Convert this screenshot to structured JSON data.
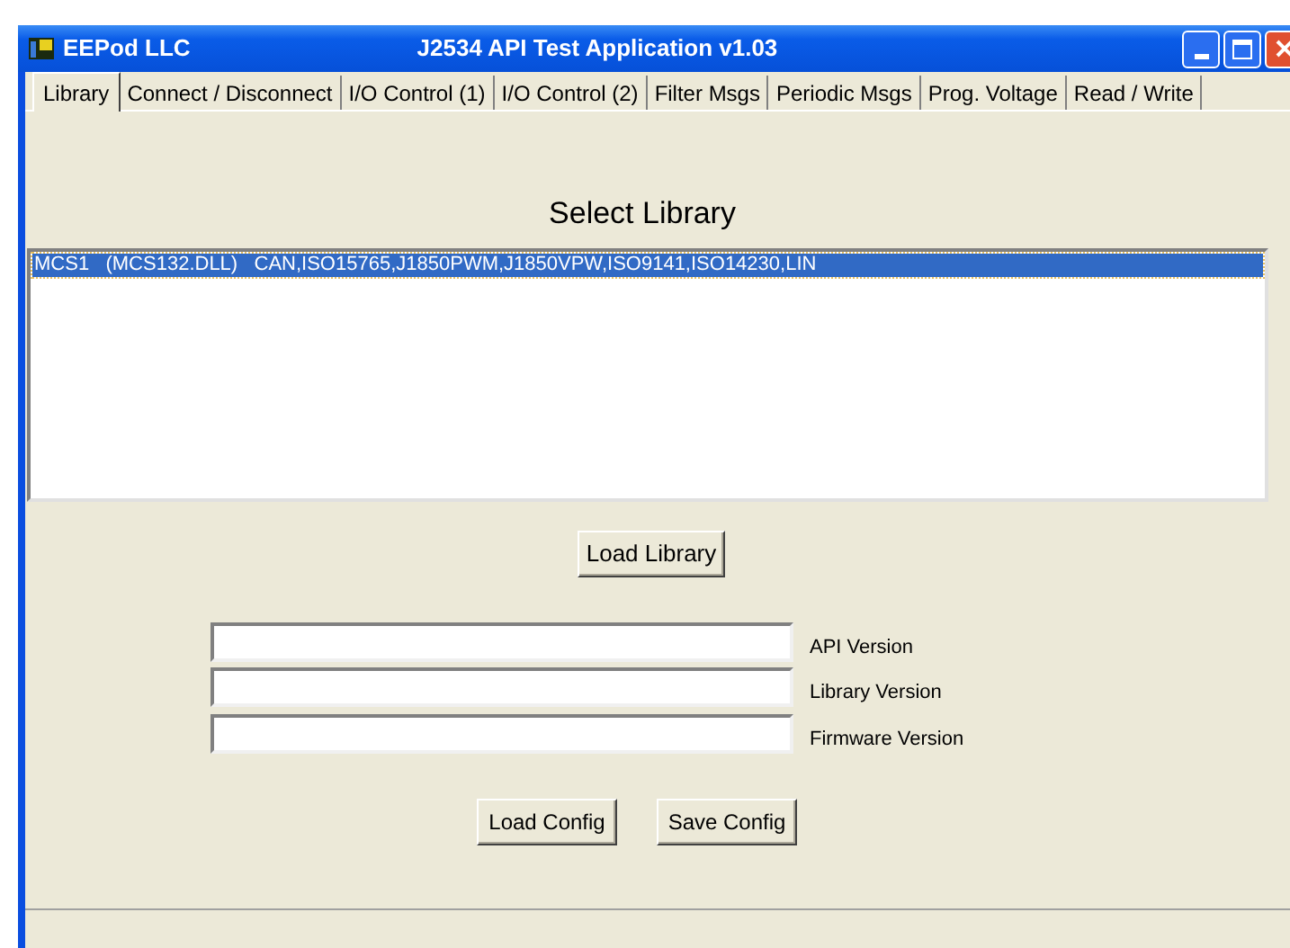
{
  "window": {
    "company": "EEPod LLC",
    "title": "J2534 API Test Application v1.03"
  },
  "tabs": [
    {
      "label": "Library",
      "selected": true
    },
    {
      "label": "Connect / Disconnect",
      "selected": false
    },
    {
      "label": "I/O Control (1)",
      "selected": false
    },
    {
      "label": "I/O Control (2)",
      "selected": false
    },
    {
      "label": "Filter Msgs",
      "selected": false
    },
    {
      "label": "Periodic Msgs",
      "selected": false
    },
    {
      "label": "Prog. Voltage",
      "selected": false
    },
    {
      "label": "Read / Write",
      "selected": false
    }
  ],
  "heading": "Select Library",
  "libraries": [
    {
      "text": "MCS1   (MCS132.DLL)   CAN,ISO15765,J1850PWM,J1850VPW,ISO9141,ISO14230,LIN",
      "selected": true
    }
  ],
  "load_button": "Load Library",
  "fields": [
    {
      "label": "API Version"
    },
    {
      "label": "Library Version"
    },
    {
      "label": "Firmware Version"
    }
  ],
  "buttons": [
    "Load Config",
    "Save Config"
  ]
}
